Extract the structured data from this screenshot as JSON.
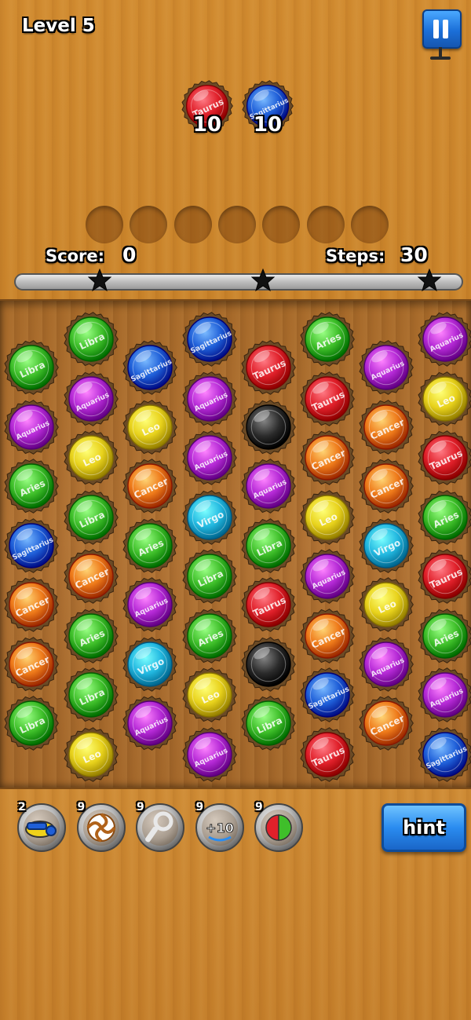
{
  "hud": {
    "level_label": "Level 5",
    "score_label": "Score:",
    "score_value": "0",
    "steps_label": "Steps:",
    "steps_value": "30",
    "progress_fraction": 0.0
  },
  "targets": [
    {
      "sign": "Taurus",
      "color": "red",
      "count": "10"
    },
    {
      "sign": "Sagittarius",
      "color": "blue",
      "count": "10"
    }
  ],
  "slots_count": 7,
  "colors": {
    "red": "#e0202a",
    "blue": "#1f5fd8",
    "green": "#3fbf2a",
    "purple": "#b52ad6",
    "yellow": "#e8d21c",
    "orange": "#ee7a1a",
    "cyan": "#22b8e0",
    "black": "#2b2b2b"
  },
  "board": {
    "columns": [
      {
        "cells": [
          {
            "color": "green",
            "sign": "Libra"
          },
          {
            "color": "purple",
            "sign": "Aquarius"
          },
          {
            "color": "green",
            "sign": "Aries"
          },
          {
            "color": "blue",
            "sign": "Sagittarius"
          },
          {
            "color": "orange",
            "sign": "Cancer"
          },
          {
            "color": "orange",
            "sign": "Cancer"
          },
          {
            "color": "green",
            "sign": "Libra"
          }
        ]
      },
      {
        "cells": [
          {
            "color": "green",
            "sign": "Libra"
          },
          {
            "color": "purple",
            "sign": "Aquarius"
          },
          {
            "color": "yellow",
            "sign": "Leo"
          },
          {
            "color": "green",
            "sign": "Libra"
          },
          {
            "color": "orange",
            "sign": "Cancer"
          },
          {
            "color": "green",
            "sign": "Aries"
          },
          {
            "color": "green",
            "sign": "Libra"
          },
          {
            "color": "yellow",
            "sign": "Leo"
          }
        ]
      },
      {
        "cells": [
          {
            "color": "blue",
            "sign": "Sagittarius"
          },
          {
            "color": "yellow",
            "sign": "Leo"
          },
          {
            "color": "orange",
            "sign": "Cancer"
          },
          {
            "color": "green",
            "sign": "Aries"
          },
          {
            "color": "purple",
            "sign": "Aquarius"
          },
          {
            "color": "cyan",
            "sign": "Virgo"
          },
          {
            "color": "purple",
            "sign": "Aquarius"
          }
        ]
      },
      {
        "cells": [
          {
            "color": "blue",
            "sign": "Sagittarius"
          },
          {
            "color": "purple",
            "sign": "Aquarius"
          },
          {
            "color": "purple",
            "sign": "Aquarius"
          },
          {
            "color": "cyan",
            "sign": "Virgo"
          },
          {
            "color": "green",
            "sign": "Libra"
          },
          {
            "color": "green",
            "sign": "Aries"
          },
          {
            "color": "yellow",
            "sign": "Leo"
          },
          {
            "color": "purple",
            "sign": "Aquarius"
          }
        ]
      },
      {
        "cells": [
          {
            "color": "red",
            "sign": "Taurus"
          },
          {
            "color": "black",
            "sign": ""
          },
          {
            "color": "purple",
            "sign": "Aquarius"
          },
          {
            "color": "green",
            "sign": "Libra"
          },
          {
            "color": "red",
            "sign": "Taurus"
          },
          {
            "color": "black",
            "sign": ""
          },
          {
            "color": "green",
            "sign": "Libra"
          }
        ]
      },
      {
        "cells": [
          {
            "color": "green",
            "sign": "Aries"
          },
          {
            "color": "red",
            "sign": "Taurus"
          },
          {
            "color": "orange",
            "sign": "Cancer"
          },
          {
            "color": "yellow",
            "sign": "Leo"
          },
          {
            "color": "purple",
            "sign": "Aquarius"
          },
          {
            "color": "orange",
            "sign": "Cancer"
          },
          {
            "color": "blue",
            "sign": "Sagittarius"
          },
          {
            "color": "red",
            "sign": "Taurus"
          }
        ]
      },
      {
        "cells": [
          {
            "color": "purple",
            "sign": "Aquarius"
          },
          {
            "color": "orange",
            "sign": "Cancer"
          },
          {
            "color": "orange",
            "sign": "Cancer"
          },
          {
            "color": "cyan",
            "sign": "Virgo"
          },
          {
            "color": "yellow",
            "sign": "Leo"
          },
          {
            "color": "purple",
            "sign": "Aquarius"
          },
          {
            "color": "orange",
            "sign": "Cancer"
          }
        ]
      },
      {
        "cells": [
          {
            "color": "purple",
            "sign": "Aquarius"
          },
          {
            "color": "yellow",
            "sign": "Leo"
          },
          {
            "color": "red",
            "sign": "Taurus"
          },
          {
            "color": "green",
            "sign": "Aries"
          },
          {
            "color": "red",
            "sign": "Taurus"
          },
          {
            "color": "green",
            "sign": "Aries"
          },
          {
            "color": "purple",
            "sign": "Aquarius"
          },
          {
            "color": "blue",
            "sign": "Sagittarius"
          }
        ]
      }
    ]
  },
  "boosters": [
    {
      "name": "whistle",
      "count": "2",
      "icon": "whistle-icon"
    },
    {
      "name": "swirl",
      "count": "9",
      "icon": "swirl-icon"
    },
    {
      "name": "bottle-opener",
      "count": "9",
      "icon": "bottle-opener-icon"
    },
    {
      "name": "plus-ten-steps",
      "count": "9",
      "icon": "plus-ten-icon",
      "label": "+10"
    },
    {
      "name": "color-swap",
      "count": "9",
      "icon": "color-swap-icon"
    }
  ],
  "hint_label": "hint"
}
